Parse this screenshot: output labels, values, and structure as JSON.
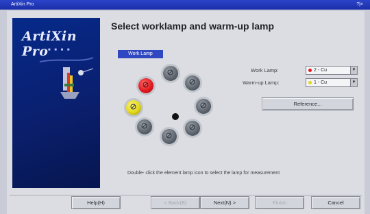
{
  "window": {
    "title": "ArtiXin Pro",
    "controls": "?|×"
  },
  "banner": {
    "logo": "ArtiXin Pro",
    "sub": "■ ■ ■ ■"
  },
  "heading": "Select worklamp and warm-up lamp",
  "turret": {
    "label": "Work Lamp",
    "colors": {
      "work": "#e3191f",
      "warmup": "#e1d51a"
    }
  },
  "fields": {
    "work_lamp_label": "Work Lamp:",
    "work_lamp_value": "2 - Cu",
    "warmup_lamp_label": "Warm-up Lamp:",
    "warmup_lamp_value": "1 - Cu",
    "reference_button": "Reference..."
  },
  "hint": "Double- click the element lamp icon to select the lamp for measurement",
  "footer": {
    "help": "Help(H)",
    "back": "< Back(B)",
    "next": "Next(N) >",
    "finish": "Finish",
    "cancel": "Cancel"
  }
}
